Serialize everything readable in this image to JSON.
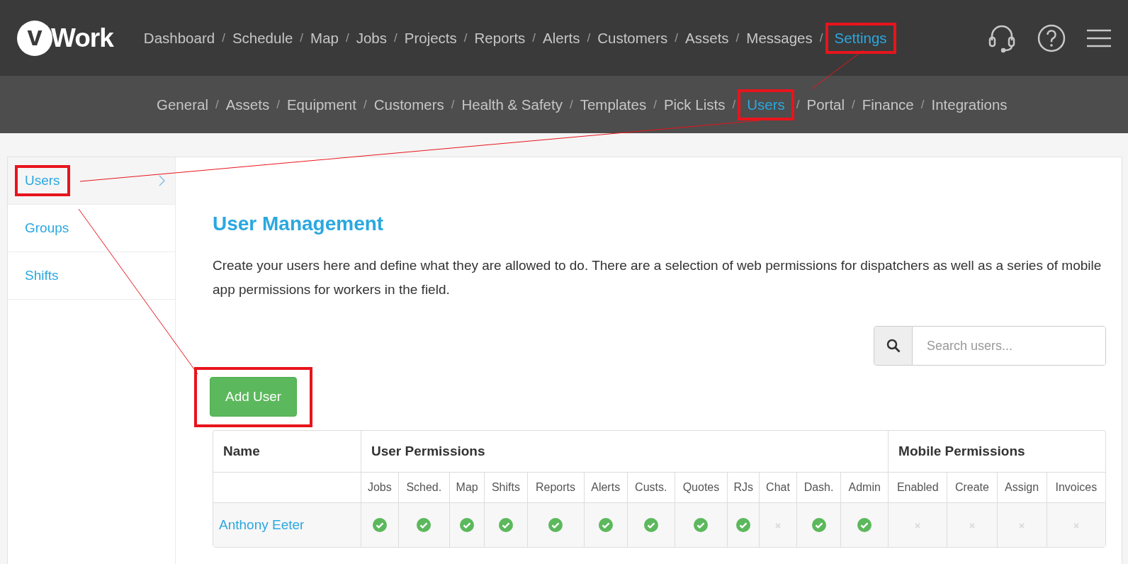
{
  "logo": {
    "text": "Work",
    "mark": "v"
  },
  "main_nav": [
    {
      "label": "Dashboard",
      "selected": false,
      "highlighted": false
    },
    {
      "label": "Schedule",
      "selected": false,
      "highlighted": false
    },
    {
      "label": "Map",
      "selected": false,
      "highlighted": false
    },
    {
      "label": "Jobs",
      "selected": false,
      "highlighted": false
    },
    {
      "label": "Projects",
      "selected": false,
      "highlighted": false
    },
    {
      "label": "Reports",
      "selected": false,
      "highlighted": false
    },
    {
      "label": "Alerts",
      "selected": false,
      "highlighted": false
    },
    {
      "label": "Customers",
      "selected": false,
      "highlighted": false
    },
    {
      "label": "Assets",
      "selected": false,
      "highlighted": false
    },
    {
      "label": "Messages",
      "selected": false,
      "highlighted": false
    },
    {
      "label": "Settings",
      "selected": true,
      "highlighted": true
    }
  ],
  "sub_nav": [
    {
      "label": "General",
      "selected": false,
      "highlighted": false
    },
    {
      "label": "Assets",
      "selected": false,
      "highlighted": false
    },
    {
      "label": "Equipment",
      "selected": false,
      "highlighted": false
    },
    {
      "label": "Customers",
      "selected": false,
      "highlighted": false
    },
    {
      "label": "Health & Safety",
      "selected": false,
      "highlighted": false
    },
    {
      "label": "Templates",
      "selected": false,
      "highlighted": false
    },
    {
      "label": "Pick Lists",
      "selected": false,
      "highlighted": false
    },
    {
      "label": "Users",
      "selected": true,
      "highlighted": true
    },
    {
      "label": "Portal",
      "selected": false,
      "highlighted": false
    },
    {
      "label": "Finance",
      "selected": false,
      "highlighted": false
    },
    {
      "label": "Integrations",
      "selected": false,
      "highlighted": false
    }
  ],
  "separator": "/",
  "sidebar": {
    "items": [
      {
        "label": "Users",
        "selected": true,
        "highlighted": true
      },
      {
        "label": "Groups",
        "selected": false,
        "highlighted": false
      },
      {
        "label": "Shifts",
        "selected": false,
        "highlighted": false
      }
    ]
  },
  "content": {
    "title": "User Management",
    "description": "Create your users here and define what they are allowed to do. There are a selection of web permissions for dispatchers as well as a series of mobile app permissions for workers in the field.",
    "search": {
      "placeholder": "Search users..."
    },
    "add_button": {
      "label": "Add User",
      "highlighted": true
    }
  },
  "table": {
    "groups": [
      "Name",
      "User Permissions",
      "Mobile Permissions"
    ],
    "user_columns": [
      "Jobs",
      "Sched.",
      "Map",
      "Shifts",
      "Reports",
      "Alerts",
      "Custs.",
      "Quotes",
      "RJs",
      "Chat",
      "Dash.",
      "Admin"
    ],
    "mobile_columns": [
      "Enabled",
      "Create",
      "Assign",
      "Invoices"
    ],
    "rows": [
      {
        "name": "Anthony Eeter",
        "user": [
          true,
          true,
          true,
          true,
          true,
          true,
          true,
          true,
          true,
          false,
          true,
          true
        ],
        "mobile": [
          false,
          false,
          false,
          false
        ]
      }
    ]
  }
}
